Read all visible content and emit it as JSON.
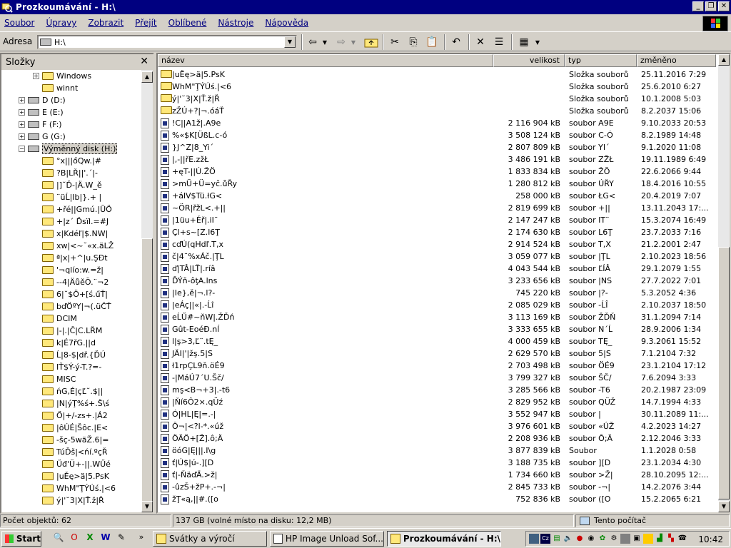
{
  "window": {
    "title": "Prozkoumávání - H:\\"
  },
  "menu": [
    "Soubor",
    "Úpravy",
    "Zobrazit",
    "Přejít",
    "Oblíbené",
    "Nástroje",
    "Nápověda"
  ],
  "address": {
    "label": "Adresa",
    "value": "H:\\"
  },
  "folders_pane": {
    "title": "Složky"
  },
  "tree": [
    {
      "label": "Windows",
      "indent": 2,
      "exp": "+",
      "icon": "folder"
    },
    {
      "label": "winnt",
      "indent": 2,
      "exp": "",
      "icon": "folder"
    },
    {
      "label": "D (D:)",
      "indent": 1,
      "exp": "+",
      "icon": "drive"
    },
    {
      "label": "E (E:)",
      "indent": 1,
      "exp": "+",
      "icon": "drive"
    },
    {
      "label": "F (F:)",
      "indent": 1,
      "exp": "+",
      "icon": "drive"
    },
    {
      "label": "G (G:)",
      "indent": 1,
      "exp": "+",
      "icon": "drive"
    },
    {
      "label": "Výměnný disk (H:)",
      "indent": 1,
      "exp": "−",
      "icon": "drive",
      "selected": true
    },
    {
      "label": "°x|||őQw.|#",
      "indent": 2,
      "exp": "",
      "icon": "folder"
    },
    {
      "label": "?B|LŘ||'.´|-",
      "indent": 2,
      "exp": "",
      "icon": "folder"
    },
    {
      "label": "|]˘Ď-|Ä.W_ě",
      "indent": 2,
      "exp": "",
      "icon": "folder"
    },
    {
      "label": "¨üĹ|Ib|}.+ |",
      "indent": 2,
      "exp": "",
      "icon": "folder"
    },
    {
      "label": "+řé||Gmú.|ÜÖ",
      "indent": 2,
      "exp": "",
      "icon": "folder"
    },
    {
      "label": "+|z´ Ďsïl.=#J",
      "indent": 2,
      "exp": "",
      "icon": "folder"
    },
    {
      "label": "x|Kdéľ|$.NW|",
      "indent": 2,
      "exp": "",
      "icon": "folder"
    },
    {
      "label": "xw|<~˘«x.äLŽ",
      "indent": 2,
      "exp": "",
      "icon": "folder"
    },
    {
      "label": "ª|x|+^|u.ŞĐt",
      "indent": 2,
      "exp": "",
      "icon": "folder"
    },
    {
      "label": "'¬qlío:w.=ž|",
      "indent": 2,
      "exp": "",
      "icon": "folder"
    },
    {
      "label": "--4|ÄůěÖ.¨¬2",
      "indent": 2,
      "exp": "",
      "icon": "folder"
    },
    {
      "label": "6|˘$Ö+[ś.űŤ|",
      "indent": 2,
      "exp": "",
      "icon": "folder"
    },
    {
      "label": "bďÖºY|¬(.üČŤ",
      "indent": 2,
      "exp": "",
      "icon": "folder"
    },
    {
      "label": "DCIM",
      "indent": 2,
      "exp": "",
      "icon": "folder"
    },
    {
      "label": "|-|.|Č|C.LŘM",
      "indent": 2,
      "exp": "",
      "icon": "folder"
    },
    {
      "label": "k|É7řG.||d",
      "indent": 2,
      "exp": "",
      "icon": "folder"
    },
    {
      "label": "Ĺ|8-$|dř.{ĎÚ",
      "indent": 2,
      "exp": "",
      "icon": "folder"
    },
    {
      "label": "IŤ$Ý-ý-T.?=-",
      "indent": 2,
      "exp": "",
      "icon": "folder"
    },
    {
      "label": "MISC",
      "indent": 2,
      "exp": "",
      "icon": "folder"
    },
    {
      "label": "ńG,É|çĽ˘.$||",
      "indent": 2,
      "exp": "",
      "icon": "folder"
    },
    {
      "label": "|N|ýŢ%ś+.Š\\ś",
      "indent": 2,
      "exp": "",
      "icon": "folder"
    },
    {
      "label": "Ő|+/-zs+.|Á2",
      "indent": 2,
      "exp": "",
      "icon": "folder"
    },
    {
      "label": "|ôÚÉ|Šôc.|E<",
      "indent": 2,
      "exp": "",
      "icon": "folder"
    },
    {
      "label": "-šç-5wäŽ.6|=",
      "indent": 2,
      "exp": "",
      "icon": "folder"
    },
    {
      "label": "TúĎš|<ńí.ºçŘ",
      "indent": 2,
      "exp": "",
      "icon": "folder"
    },
    {
      "label": "Űđ'Ü+-||.WŰé",
      "indent": 2,
      "exp": "",
      "icon": "folder"
    },
    {
      "label": "|uĚę>ä|5.PsK",
      "indent": 2,
      "exp": "",
      "icon": "folder"
    },
    {
      "label": "WhM\"ŢÝÚś.|<6",
      "indent": 2,
      "exp": "",
      "icon": "folder"
    },
    {
      "label": "ý|'˘3|X|Ť.ž|Ř",
      "indent": 2,
      "exp": "",
      "icon": "folder"
    }
  ],
  "columns": {
    "name": "název",
    "size": "velikost",
    "type": "typ",
    "date": "změněno"
  },
  "files": [
    {
      "name": "|uĚę>ä|5.PsK",
      "size": "",
      "type": "Složka souborů",
      "date": "25.11.2016 7:29",
      "icon": "folder"
    },
    {
      "name": "WhM\"ŢÝÚś.|<6",
      "size": "",
      "type": "Složka souborů",
      "date": "25.6.2010 6:27",
      "icon": "folder"
    },
    {
      "name": "ý|'˘3|X|Ť.ž|Ř",
      "size": "",
      "type": "Složka souborů",
      "date": "10.1.2008 5:03",
      "icon": "folder"
    },
    {
      "name": "zŽÚ+?|¬.óáŤ",
      "size": "",
      "type": "Složka souborů",
      "date": "8.2.2037 15:06",
      "icon": "folder"
    },
    {
      "name": "!C||A1ž|.A9e",
      "size": "2 116 904 kB",
      "type": "soubor A9E",
      "date": "9.10.2033 20:53",
      "icon": "file"
    },
    {
      "name": "%«$K[ÜßL.c-ó",
      "size": "3 508 124 kB",
      "type": "soubor C-Ó",
      "date": "8.2.1989 14:48",
      "icon": "file"
    },
    {
      "name": "}J^Z|8_Yi´",
      "size": "2 807 809 kB",
      "type": "soubor YI´",
      "date": "9.1.2020 11:08",
      "icon": "file"
    },
    {
      "name": "|,-||řE.zžŁ",
      "size": "3 486 191 kB",
      "type": "soubor ZŽŁ",
      "date": "19.11.1989 6:49",
      "icon": "file"
    },
    {
      "name": "+ęT-||Ú.ŽÖ",
      "size": "1 833 834 kB",
      "type": "soubor ŽÖ",
      "date": "22.6.2066 9:44",
      "icon": "file"
    },
    {
      "name": ">mÜ+Ü=yč.ůŘy",
      "size": "1 280 812 kB",
      "type": "soubor ÚŘY",
      "date": "18.4.2016 10:55",
      "icon": "file"
    },
    {
      "name": "+álV$Tü.łG<",
      "size": "258 000 kB",
      "type": "soubor ŁG<",
      "date": "20.4.2019 7:07",
      "icon": "file"
    },
    {
      "name": "~ÖR|řžL<.+||",
      "size": "2 819 699 kB",
      "type": "soubor +||",
      "date": "13.11.2043 17:...",
      "icon": "file"
    },
    {
      "name": "|1üu+Éř|.iI¨",
      "size": "2 147 247 kB",
      "type": "soubor IT¨",
      "date": "15.3.2074 16:49",
      "icon": "file"
    },
    {
      "name": "Çl+s~[Z.l6Ţ",
      "size": "2 174 630 kB",
      "type": "soubor L6Ţ",
      "date": "23.7.2033 7:16",
      "icon": "file"
    },
    {
      "name": "cďÚ(qHdľ.T,x",
      "size": "2 914 524 kB",
      "type": "soubor T,X",
      "date": "21.2.2001 2:47",
      "icon": "file"
    },
    {
      "name": "č|4¨%xÁč.|ŢL",
      "size": "3 059 077 kB",
      "type": "soubor |ŢL",
      "date": "2.10.2023 18:56",
      "icon": "file"
    },
    {
      "name": "ď|TÂ|LŤ|.ríâ",
      "size": "4 043 544 kB",
      "type": "soubor ĽÍÂ",
      "date": "29.1.2079 1:55",
      "icon": "file"
    },
    {
      "name": "ĎÝň-ôţA.lns",
      "size": "3 233 656 kB",
      "type": "soubor |NS",
      "date": "27.7.2022 7:01",
      "icon": "file"
    },
    {
      "name": "|Ie},ě|¬.l?-",
      "size": "745 220 kB",
      "type": "soubor |?-",
      "date": "5.3.2052 4:36",
      "icon": "file"
    },
    {
      "name": "|eÁç||«|.-Ĺî",
      "size": "2 085 029 kB",
      "type": "soubor -ĹÎ",
      "date": "2.10.2037 18:50",
      "icon": "file"
    },
    {
      "name": "eĹŰ#~ňW|.ŽĎń",
      "size": "3 113 169 kB",
      "type": "soubor ŽĎŇ",
      "date": "31.1.2094 7:14",
      "icon": "file"
    },
    {
      "name": "Gût-EoéĐ.nĺ",
      "size": "3 333 655 kB",
      "type": "soubor N´Ĺ",
      "date": "28.9.2006 1:34",
      "icon": "file"
    },
    {
      "name": "l|ş>3,Ľ¨.tĘ_",
      "size": "4 000 459 kB",
      "type": "soubor TĘ_",
      "date": "9.3.2061 15:52",
      "icon": "file"
    },
    {
      "name": "JÄI|'|žş.5|S",
      "size": "2 629 570 kB",
      "type": "soubor 5|S",
      "date": "7.1.2104 7:32",
      "icon": "file"
    },
    {
      "name": "ł1rpÇL9ň.öÉ9",
      "size": "2 703 498 kB",
      "type": "soubor ÖÉ9",
      "date": "23.1.2104 17:12",
      "icon": "file"
    },
    {
      "name": "-|MáÚ7´U.Šč/",
      "size": "3 799 327 kB",
      "type": "soubor ŠČ/",
      "date": "7.6.2094 3:33",
      "icon": "file"
    },
    {
      "name": "mş<B¬+3|.-t6",
      "size": "3 285 566 kB",
      "type": "soubor -T6",
      "date": "20.2.1987 23:09",
      "icon": "file"
    },
    {
      "name": "|Ňí6Ô2×.qÜź",
      "size": "2 829 952 kB",
      "type": "soubor QÜŽ",
      "date": "14.7.1994 4:33",
      "icon": "file"
    },
    {
      "name": "Ó|HL|Ę|=.-|",
      "size": "3 552 947 kB",
      "type": "soubor |",
      "date": "30.11.2089 11:...",
      "icon": "file"
    },
    {
      "name": "Ô¬|<?l-*.«úž",
      "size": "3 976 601 kB",
      "type": "soubor «ÚŽ",
      "date": "4.2.2023 14:27",
      "icon": "file"
    },
    {
      "name": "ÖÄÖ+[Ž].ô;Ä",
      "size": "2 208 936 kB",
      "type": "soubor Ô;Ä",
      "date": "2.12.2046 3:33",
      "icon": "file"
    },
    {
      "name": "öóG|Ę|||.I\\g",
      "size": "3 877 839 kB",
      "type": "Soubor",
      "date": "1.1.2028 0:58",
      "icon": "file"
    },
    {
      "name": "ť|Ú$|ú-.][D",
      "size": "3 188 735 kB",
      "type": "soubor ][D",
      "date": "23.1.2034 4:30",
      "icon": "file"
    },
    {
      "name": "ť|-ŇäďÄ.>ž|",
      "size": "1 734 660 kB",
      "type": "soubor >Ž|",
      "date": "28.10.2095 12:...",
      "icon": "file"
    },
    {
      "name": "-ûzŠ+žP+.-¬|",
      "size": "2 845 733 kB",
      "type": "soubor -¬|",
      "date": "14.2.2076 3:44",
      "icon": "file"
    },
    {
      "name": "žŢ«ą,||#.([o",
      "size": "752 836 kB",
      "type": "soubor ([O",
      "date": "15.2.2065 6:21",
      "icon": "file"
    }
  ],
  "status": {
    "objects": "Počet objektů: 62",
    "space": "137 GB (volné místo na disku: 12,2 MB)",
    "location": "Tento počítač"
  },
  "taskbar": {
    "start": "Start",
    "tasks": [
      "Svátky a výročí",
      "HP Image Unload Sof...",
      "Prozkoumávání - H:\\"
    ],
    "clock": "10:42"
  }
}
